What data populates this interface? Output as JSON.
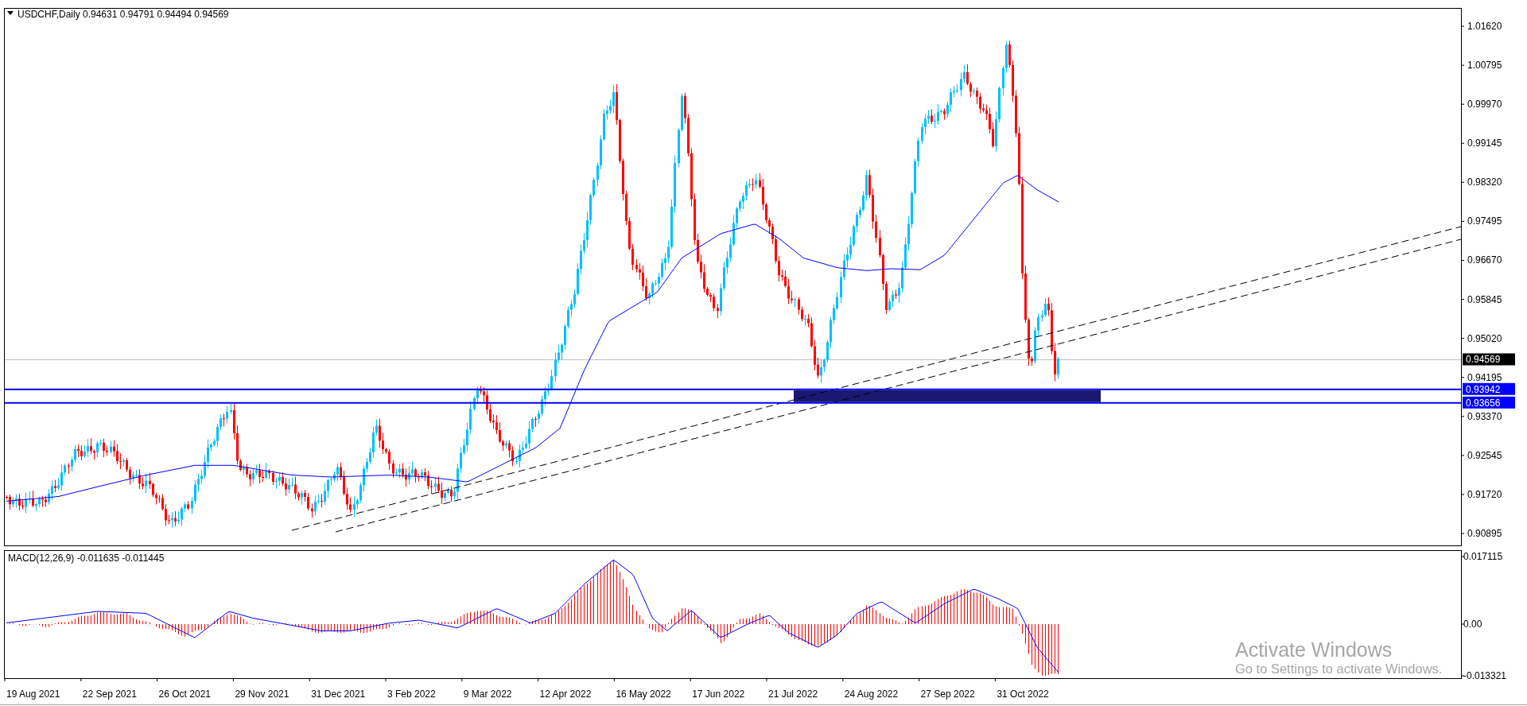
{
  "chart": {
    "symbol": "USDCHF,Daily",
    "ohlc": [
      "0.94631",
      "0.94791",
      "0.94494",
      "0.94569"
    ],
    "price_axis": [
      "1.01620",
      "1.00795",
      "0.99970",
      "0.99145",
      "0.98320",
      "0.97495",
      "0.96670",
      "0.95845",
      "0.95020",
      "0.94195",
      "0.93370",
      "0.92545",
      "0.91720",
      "0.90895"
    ],
    "current_price": "0.94569",
    "levels": [
      {
        "label": "0.93942"
      },
      {
        "label": "0.93656"
      }
    ],
    "macd": {
      "header": "MACD(12,26,9) -0.011635 -0.011445",
      "axis": [
        "0.017115",
        "0.00",
        "-0.013321"
      ]
    },
    "date_axis": [
      "19 Aug 2021",
      "22 Sep 2021",
      "26 Oct 2021",
      "29 Nov 2021",
      "31 Dec 2021",
      "3 Feb 2022",
      "9 Mar 2022",
      "12 Apr 2022",
      "16 May 2022",
      "17 Jun 2022",
      "21 Jul 2022",
      "24 Aug 2022",
      "27 Sep 2022",
      "31 Oct 2022"
    ]
  },
  "os_notice": {
    "title": "Activate Windows",
    "text": "Go to Settings to activate Windows."
  }
}
